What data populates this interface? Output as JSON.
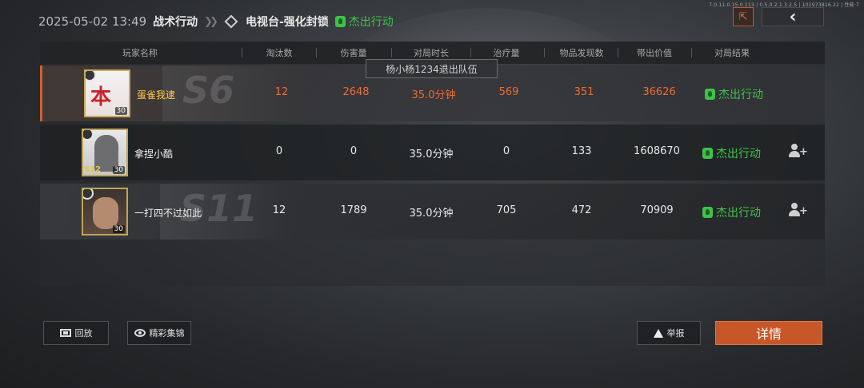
{
  "header": {
    "timestamp": "2025-05-02 13:49",
    "mode": "战术行动",
    "map": "电视台-强化封锁",
    "result": "杰出行动",
    "result_icon": "leaf-icon",
    "debug": "7.0.11.0.15.0.113 | 0.5.0.2.1.3.2.5 | 101973816.22 | 性能·7"
  },
  "toast": "杨小杨1234退出队伍",
  "table": {
    "headers": [
      "玩家名称",
      "淘汰数",
      "伤害量",
      "对局时长",
      "治疗量",
      "物品发现数",
      "带出价值",
      "对局结果"
    ],
    "rows": [
      {
        "name": "蛋雀我逮",
        "eliminations": "12",
        "damage": "2648",
        "duration": "35.0分钟",
        "healing": "569",
        "items_found": "351",
        "extract_value": "36626",
        "result": "杰出行动",
        "level": "30",
        "avatar_text": "本",
        "deco": "S6",
        "highlight": true
      },
      {
        "name": "拿捏小酷",
        "eliminations": "0",
        "damage": "0",
        "duration": "35.0分钟",
        "healing": "0",
        "items_found": "133",
        "extract_value": "1608670",
        "result": "杰出行动",
        "level": "30",
        "season": "S12"
      },
      {
        "name": "一打四不过如此",
        "eliminations": "12",
        "damage": "1789",
        "duration": "35.0分钟",
        "healing": "705",
        "items_found": "472",
        "extract_value": "70909",
        "result": "杰出行动",
        "level": "30",
        "deco": "S11"
      }
    ]
  },
  "footer": {
    "replay": "回放",
    "highlights": "精彩集锦",
    "report": "举报",
    "details": "详情"
  },
  "colors": {
    "accent_orange": "#c75628",
    "success_green": "#3fc24a",
    "highlight_gold": "#ffc94a"
  }
}
